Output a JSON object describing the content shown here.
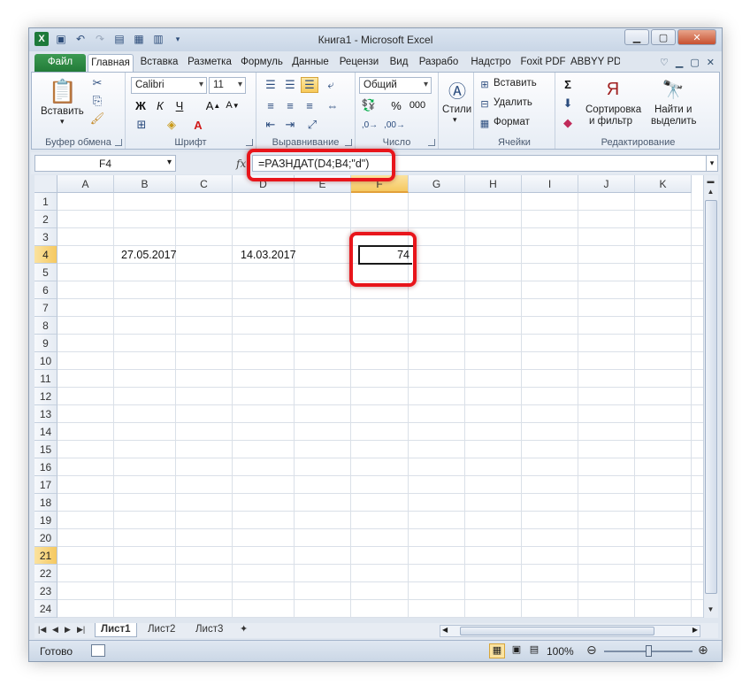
{
  "window": {
    "title": "Книга1 - Microsoft Excel"
  },
  "tabs": [
    "Файл",
    "Главная",
    "Вставка",
    "Разметка",
    "Формуль",
    "Данные",
    "Рецензи",
    "Вид",
    "Разрабо",
    "Надстро",
    "Foxit PDF",
    "ABBYY PD"
  ],
  "ribbon": {
    "paste": "Вставить",
    "clipboard": "Буфер обмена",
    "font_name": "Calibri",
    "font_size": "11",
    "font_group": "Шрифт",
    "bold": "Ж",
    "italic": "К",
    "underline": "Ч",
    "align_group": "Выравнивание",
    "number_format": "Общий",
    "number_group": "Число",
    "percent": "%",
    "thousands": "000",
    "styles": "Стили",
    "insert": "Вставить",
    "delete": "Удалить",
    "format": "Формат",
    "cells_group": "Ячейки",
    "sort1": "Сортировка",
    "sort2": "и фильтр",
    "find1": "Найти и",
    "find2": "выделить",
    "editing_group": "Редактирование"
  },
  "formula_bar": {
    "name_box": "F4",
    "fx": "fx",
    "formula": "=РАЗНДАТ(D4;B4;\"d\")"
  },
  "columns": [
    "A",
    "B",
    "C",
    "D",
    "E",
    "F",
    "G",
    "H",
    "I",
    "J",
    "K"
  ],
  "rows": [
    "1",
    "2",
    "3",
    "4",
    "5",
    "6",
    "7",
    "8",
    "9",
    "10",
    "11",
    "12",
    "13",
    "14",
    "15",
    "16",
    "17",
    "18",
    "19",
    "20",
    "21",
    "22",
    "23",
    "24"
  ],
  "cells": {
    "B4": "27.05.2017",
    "D4": "14.03.2017",
    "F4": "74"
  },
  "sheets": [
    "Лист1",
    "Лист2",
    "Лист3"
  ],
  "status": {
    "ready": "Готово",
    "zoom": "100%"
  },
  "colors": {
    "file_tab": "#217a37",
    "selection": "#f5c860",
    "annotation": "#e8151b"
  }
}
